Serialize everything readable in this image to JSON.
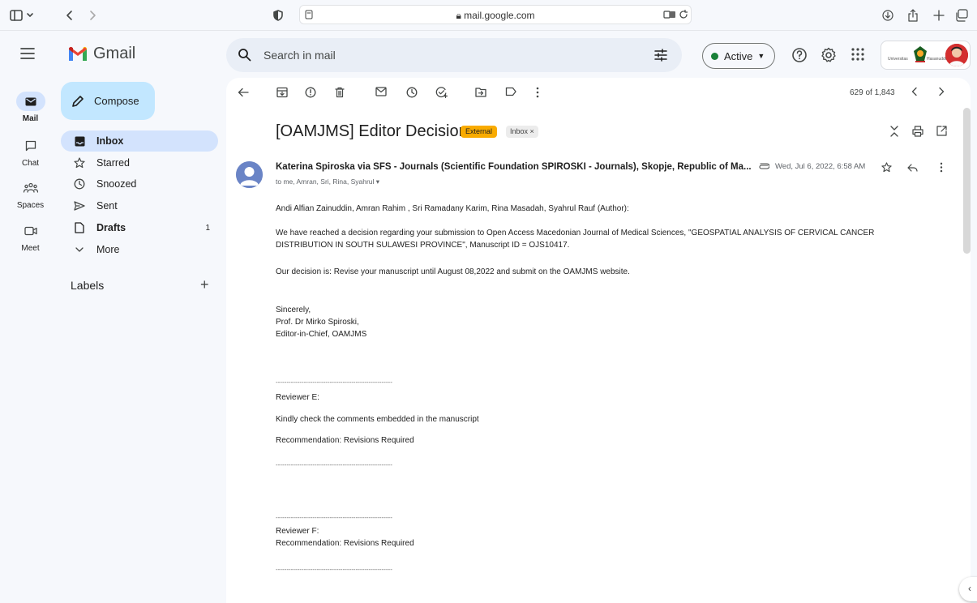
{
  "browser": {
    "url_domain": "mail.google.com"
  },
  "header": {
    "brand": "Gmail",
    "search_placeholder": "Search in mail",
    "status_label": "Active"
  },
  "rail": [
    {
      "label": "Mail",
      "icon": "mail-icon"
    },
    {
      "label": "Chat",
      "icon": "chat-icon"
    },
    {
      "label": "Spaces",
      "icon": "spaces-icon"
    },
    {
      "label": "Meet",
      "icon": "meet-icon"
    }
  ],
  "nav": {
    "compose_label": "Compose",
    "items": [
      {
        "label": "Inbox",
        "count": ""
      },
      {
        "label": "Starred",
        "count": ""
      },
      {
        "label": "Snoozed",
        "count": ""
      },
      {
        "label": "Sent",
        "count": ""
      },
      {
        "label": "Drafts",
        "count": "1"
      },
      {
        "label": "More",
        "count": ""
      }
    ],
    "labels_heading": "Labels"
  },
  "message": {
    "range": "629 of 1,843",
    "subject": "[OAMJMS] Editor Decision",
    "tag_external": "External",
    "tag_inbox": "Inbox ×",
    "sender": "Katerina Spiroska via SFS - Journals (Scientific Foundation SPIROSKI - Journals), Skopje, Republic of Ma...",
    "recipients": "to me, Amran, Sri, Rina, Syahrul ▾",
    "date": "Wed, Jul 6, 2022, 6:58 AM",
    "body": [
      "Andi Alfian Zainuddin, Amran Rahim , Sri Ramadany Karim, Rina Masadah, Syahrul Rauf (Author):",
      "We have reached a decision regarding your submission to Open Access Macedonian Journal of Medical Sciences, \"GEOSPATIAL ANALYSIS OF CERVICAL CANCER",
      "DISTRIBUTION IN SOUTH SULAWESI PROVINCE\", Manuscript ID = OJS10417.",
      "Our decision is: Revise your manuscript until August 08,2022 and submit on the OAMJMS website.",
      "Sincerely,",
      "Prof. Dr Mirko Spiroski,",
      "Editor-in-Chief, OAMJMS",
      "------------------------------------------------------",
      "Reviewer E:",
      "Kindly check the comments embedded in the manuscript",
      "Recommendation: Revisions Required",
      "------------------------------------------------------",
      "------------------------------------------------------",
      "Reviewer F:",
      "Recommendation: Revisions Required",
      "------------------------------------------------------"
    ]
  },
  "org": {
    "text_left": "Universitas",
    "text_right": "Hasanuddin"
  }
}
